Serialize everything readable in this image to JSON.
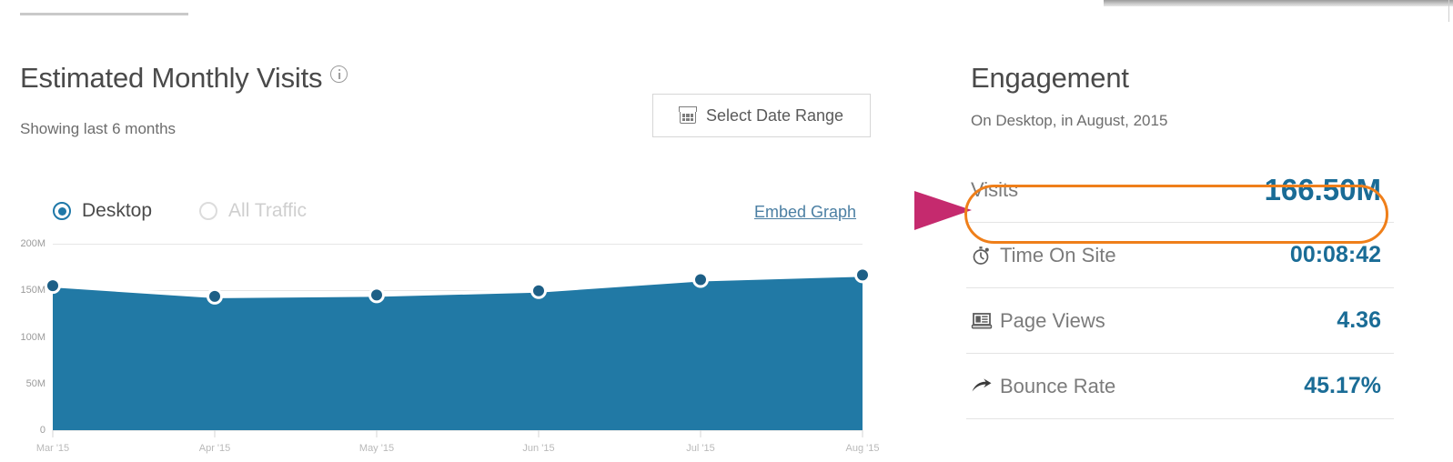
{
  "chart_panel": {
    "title": "Estimated Monthly Visits",
    "info_icon": "info-icon",
    "subtitle": "Showing last 6 months",
    "date_range_button": "Select Date Range",
    "date_range_icon": "calendar-icon",
    "embed_link": "Embed Graph",
    "radios": [
      {
        "label": "Desktop",
        "selected": true
      },
      {
        "label": "All Traffic",
        "selected": false
      }
    ]
  },
  "engagement_panel": {
    "title": "Engagement",
    "subtitle": "On Desktop, in August, 2015",
    "metrics": [
      {
        "label": "Visits",
        "value": "166.50M",
        "icon": "none",
        "highlighted": true
      },
      {
        "label": "Time On Site",
        "value": "00:08:42",
        "icon": "stopwatch-icon",
        "highlighted": false
      },
      {
        "label": "Page Views",
        "value": "4.36",
        "icon": "page-icon",
        "highlighted": false
      },
      {
        "label": "Bounce Rate",
        "value": "45.17%",
        "icon": "bounce-arrow-icon",
        "highlighted": false
      }
    ]
  },
  "annotations": {
    "arrow_color": "#c52a6e",
    "ellipse_color": "#ef7f1a",
    "arrow_target": "Visits"
  },
  "colors": {
    "area_fill": "#2179a5",
    "line_stroke": "#ffffff",
    "value_text": "#1a6c96",
    "accent_orange": "#ef7f1a",
    "accent_magenta": "#c52a6e"
  },
  "chart_data": {
    "type": "area",
    "title": "Estimated Monthly Visits",
    "xlabel": "",
    "ylabel": "",
    "ylim": [
      0,
      200
    ],
    "yticks": [
      0,
      50,
      100,
      150,
      200
    ],
    "ytick_labels": [
      "0",
      "50M",
      "100M",
      "150M",
      "200M"
    ],
    "grid": true,
    "legend": "none",
    "categories": [
      "Mar '15",
      "Apr '15",
      "May '15",
      "Jun '15",
      "Jul '15",
      "Aug '15"
    ],
    "series": [
      {
        "name": "Desktop",
        "values": [
          155.0,
          143.5,
          145.0,
          149.5,
          161.5,
          166.5
        ]
      }
    ]
  }
}
